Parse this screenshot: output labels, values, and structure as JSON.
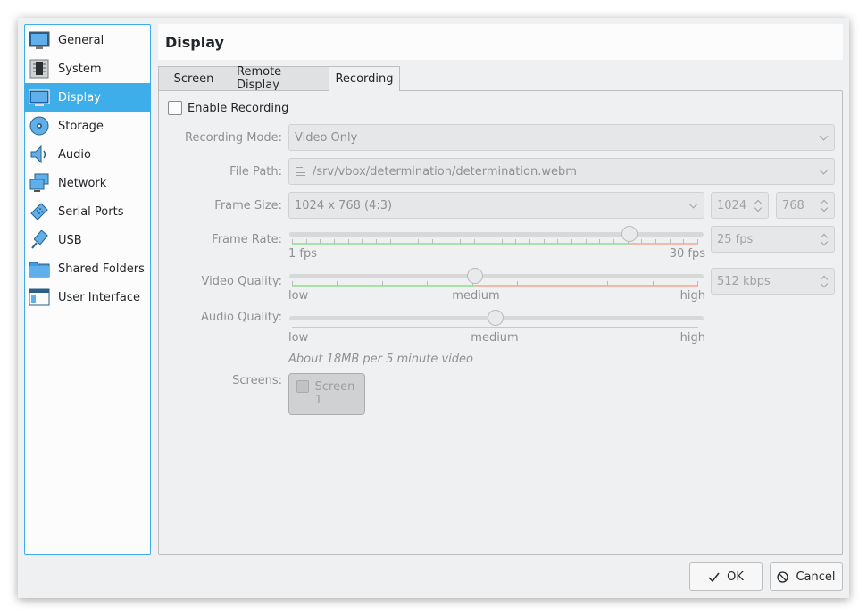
{
  "sidebar": {
    "items": [
      {
        "label": "General",
        "icon": "general-icon"
      },
      {
        "label": "System",
        "icon": "system-icon"
      },
      {
        "label": "Display",
        "icon": "display-icon",
        "selected": true
      },
      {
        "label": "Storage",
        "icon": "storage-icon"
      },
      {
        "label": "Audio",
        "icon": "audio-icon"
      },
      {
        "label": "Network",
        "icon": "network-icon"
      },
      {
        "label": "Serial Ports",
        "icon": "serial-ports-icon"
      },
      {
        "label": "USB",
        "icon": "usb-icon"
      },
      {
        "label": "Shared Folders",
        "icon": "shared-folders-icon"
      },
      {
        "label": "User Interface",
        "icon": "user-interface-icon"
      }
    ]
  },
  "header": {
    "title": "Display"
  },
  "tabs": [
    {
      "label": "Screen"
    },
    {
      "label": "Remote Display"
    },
    {
      "label": "Recording",
      "active": true
    }
  ],
  "recording": {
    "enable_label": "Enable Recording",
    "enabled": false,
    "mode_label": "Recording Mode:",
    "mode_value": "Video Only",
    "path_label": "File Path:",
    "path_value": "/srv/vbox/determination/determination.webm",
    "size_label": "Frame Size:",
    "size_value": "1024 x 768 (4:3)",
    "width_value": "1024",
    "height_value": "768",
    "rate_label": "Frame Rate:",
    "rate_min": "1 fps",
    "rate_max": "30 fps",
    "rate_value": "25 fps",
    "rate_fraction": 0.83,
    "vq_label": "Video Quality:",
    "vq_low": "low",
    "vq_medium": "medium",
    "vq_high": "high",
    "vq_value": "512 kbps",
    "vq_fraction": 0.45,
    "aq_label": "Audio Quality:",
    "aq_low": "low",
    "aq_medium": "medium",
    "aq_high": "high",
    "aq_fraction": 0.5,
    "estimate": "About 18MB per 5 minute video",
    "screens_label": "Screens:",
    "screen1_label": "Screen 1"
  },
  "buttons": {
    "ok": "OK",
    "cancel": "Cancel"
  },
  "colors": {
    "accent": "#3daee9",
    "window_bg": "#eff0f1"
  }
}
